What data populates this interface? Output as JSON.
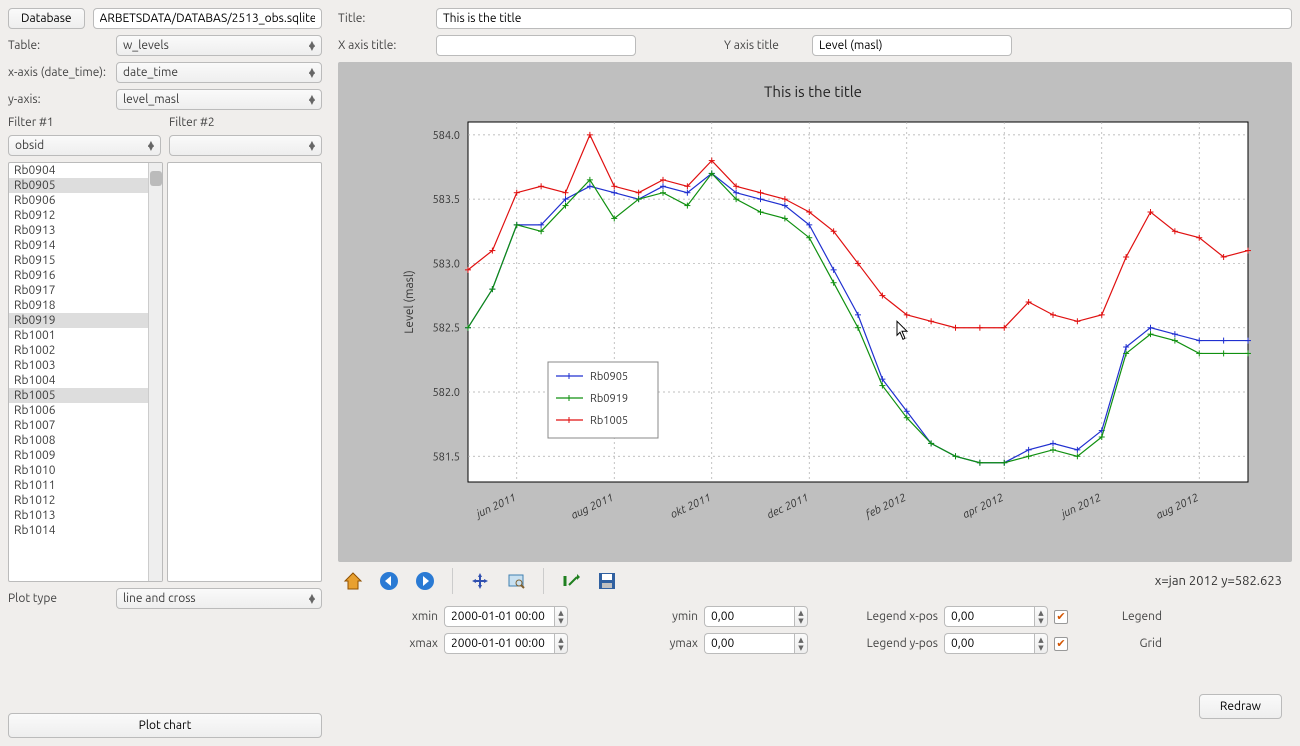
{
  "left": {
    "database_button": "Database",
    "database_path": "ARBETSDATA/DATABAS/2513_obs.sqlite",
    "table_label": "Table:",
    "table_value": "w_levels",
    "xaxis_label": "x-axis (date_time):",
    "xaxis_value": "date_time",
    "yaxis_label": "y-axis:",
    "yaxis_value": "level_masl",
    "filter1_label": "Filter #1",
    "filter2_label": "Filter #2",
    "filter1_combo": "obsid",
    "filter2_combo": "",
    "obs_list": [
      "Rb0904",
      "Rb0905",
      "Rb0906",
      "Rb0912",
      "Rb0913",
      "Rb0914",
      "Rb0915",
      "Rb0916",
      "Rb0917",
      "Rb0918",
      "Rb0919",
      "Rb1001",
      "Rb1002",
      "Rb1003",
      "Rb1004",
      "Rb1005",
      "Rb1006",
      "Rb1007",
      "Rb1008",
      "Rb1009",
      "Rb1010",
      "Rb1011",
      "Rb1012",
      "Rb1013",
      "Rb1014"
    ],
    "obs_selected": [
      "Rb0905",
      "Rb0919",
      "Rb1005"
    ],
    "plot_type_label": "Plot type",
    "plot_type_value": "line and cross",
    "plot_chart_button": "Plot chart"
  },
  "right_top": {
    "title_label": "Title:",
    "title_value": "This is the title",
    "xaxis_title_label": "X axis title:",
    "xaxis_title_value": "",
    "yaxis_title_label": "Y axis title",
    "yaxis_title_value": "Level (masl)"
  },
  "toolbar": {
    "home": "home-icon",
    "back": "back-icon",
    "forward": "forward-icon",
    "pan": "pan-icon",
    "zoom": "zoom-icon",
    "subplots": "subplots-icon",
    "save": "save-icon"
  },
  "status": {
    "coords": "x=jan 2012 y=582.623"
  },
  "bottom": {
    "xmin_label": "xmin",
    "xmin_value": "2000-01-01 00:00",
    "xmax_label": "xmax",
    "xmax_value": "2000-01-01 00:00",
    "ymin_label": "ymin",
    "ymin_value": "0,00",
    "ymax_label": "ymax",
    "ymax_value": "0,00",
    "legx_label": "Legend x-pos",
    "legx_value": "0,00",
    "legy_label": "Legend y-pos",
    "legy_value": "0,00",
    "legend_check": "Legend",
    "grid_check": "Grid",
    "redraw_button": "Redraw"
  },
  "chart_data": {
    "type": "line",
    "title": "This is the title",
    "xlabel": "",
    "ylabel": "Level (masl)",
    "ylim": [
      581.3,
      584.1
    ],
    "xlim": [
      0,
      16
    ],
    "x_ticks": [
      1,
      3,
      5,
      7,
      9,
      11,
      13,
      15
    ],
    "x_tick_labels": [
      "jun 2011",
      "aug 2011",
      "okt 2011",
      "dec 2011",
      "feb 2012",
      "apr 2012",
      "jun 2012",
      "aug 2012"
    ],
    "y_ticks": [
      581.5,
      582.0,
      582.5,
      583.0,
      583.5,
      584.0
    ],
    "grid": true,
    "legend_pos": "inside-lower-left",
    "series": [
      {
        "name": "Rb0905",
        "color": "#2030d0",
        "x": [
          0,
          0.5,
          1,
          1.5,
          2,
          2.5,
          3,
          3.5,
          4,
          4.5,
          5,
          5.5,
          6,
          6.5,
          7,
          7.5,
          8,
          8.5,
          9,
          9.5,
          10,
          10.5,
          11,
          11.5,
          12,
          12.5,
          13,
          13.5,
          14,
          14.5,
          15,
          15.5,
          16
        ],
        "y": [
          582.5,
          582.8,
          583.3,
          583.3,
          583.5,
          583.6,
          583.55,
          583.5,
          583.6,
          583.55,
          583.7,
          583.55,
          583.5,
          583.45,
          583.3,
          582.95,
          582.6,
          582.1,
          581.85,
          581.6,
          581.5,
          581.45,
          581.45,
          581.55,
          581.6,
          581.55,
          581.7,
          582.35,
          582.5,
          582.45,
          582.4,
          582.4,
          582.4
        ]
      },
      {
        "name": "Rb0919",
        "color": "#109010",
        "x": [
          0,
          0.5,
          1,
          1.5,
          2,
          2.5,
          3,
          3.5,
          4,
          4.5,
          5,
          5.5,
          6,
          6.5,
          7,
          7.5,
          8,
          8.5,
          9,
          9.5,
          10,
          10.5,
          11,
          11.5,
          12,
          12.5,
          13,
          13.5,
          14,
          14.5,
          15,
          15.5,
          16
        ],
        "y": [
          582.5,
          582.8,
          583.3,
          583.25,
          583.45,
          583.65,
          583.35,
          583.5,
          583.55,
          583.45,
          583.7,
          583.5,
          583.4,
          583.35,
          583.2,
          582.85,
          582.5,
          582.05,
          581.8,
          581.6,
          581.5,
          581.45,
          581.45,
          581.5,
          581.55,
          581.5,
          581.65,
          582.3,
          582.45,
          582.4,
          582.3,
          582.3,
          582.3
        ]
      },
      {
        "name": "Rb1005",
        "color": "#e01010",
        "x": [
          0,
          0.5,
          1,
          1.5,
          2,
          2.5,
          3,
          3.5,
          4,
          4.5,
          5,
          5.5,
          6,
          6.5,
          7,
          7.5,
          8,
          8.5,
          9,
          9.5,
          10,
          10.5,
          11,
          11.5,
          12,
          12.5,
          13,
          13.5,
          14,
          14.5,
          15,
          15.5,
          16
        ],
        "y": [
          582.95,
          583.1,
          583.55,
          583.6,
          583.55,
          584.0,
          583.6,
          583.55,
          583.65,
          583.6,
          583.8,
          583.6,
          583.55,
          583.5,
          583.4,
          583.25,
          583.0,
          582.75,
          582.6,
          582.55,
          582.5,
          582.5,
          582.5,
          582.7,
          582.6,
          582.55,
          582.6,
          583.05,
          583.4,
          583.25,
          583.2,
          583.05,
          583.1
        ]
      }
    ]
  }
}
